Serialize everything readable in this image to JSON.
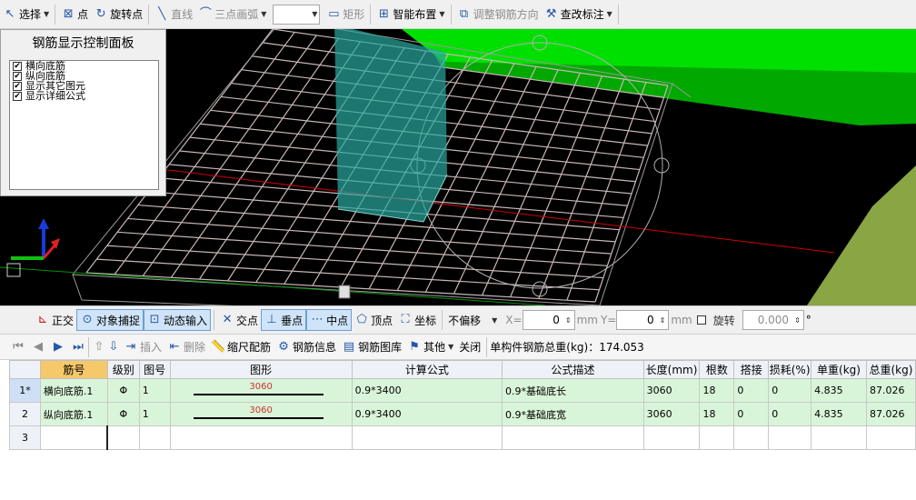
{
  "toolbar_top": {
    "select": "选择",
    "point": "点",
    "rotate_point": "旋转点",
    "line": "直线",
    "arc": "三点画弧",
    "rect": "矩形",
    "smart_layout": "智能布置",
    "adjust_dir": "调整钢筋方向",
    "check_label": "查改标注"
  },
  "panel": {
    "title": "钢筋显示控制面板",
    "items": [
      "横向底筋",
      "纵向底筋",
      "显示其它图元",
      "显示详细公式"
    ]
  },
  "toolbar_snap": {
    "ortho": "正交",
    "snap": "对象捕捉",
    "dynamic": "动态输入",
    "intersect": "交点",
    "perp": "垂点",
    "mid": "中点",
    "vertex": "顶点",
    "coord": "坐标",
    "offset": "不偏移",
    "x_label": "X=",
    "x_val": "0",
    "mm1": "mm",
    "y_label": "Y=",
    "y_val": "0",
    "mm2": "mm",
    "rotate": "旋转",
    "rotate_val": "0.000",
    "deg": "°"
  },
  "toolbar_grid": {
    "insert": "插入",
    "delete": "删除",
    "scale": "缩尺配筋",
    "info": "钢筋信息",
    "lib": "钢筋图库",
    "other": "其他",
    "close": "关闭",
    "total": "单构件钢筋总重(kg)：174.053"
  },
  "table": {
    "headers": [
      "",
      "筋号",
      "级别",
      "图号",
      "图形",
      "计算公式",
      "公式描述",
      "长度(mm)",
      "根数",
      "搭接",
      "损耗(%)",
      "单重(kg)",
      "总重(kg)"
    ],
    "rows": [
      {
        "no": "1*",
        "name": "横向底筋.1",
        "grade": "Φ",
        "fig": "1",
        "len_label": "3060",
        "formula": "0.9*3400",
        "desc": "0.9*基础底长",
        "length": "3060",
        "count": "18",
        "lap": "0",
        "loss": "0",
        "unit_w": "4.835",
        "total_w": "87.026"
      },
      {
        "no": "2",
        "name": "纵向底筋.1",
        "grade": "Φ",
        "fig": "1",
        "len_label": "3060",
        "formula": "0.9*3400",
        "desc": "0.9*基础底宽",
        "length": "3060",
        "count": "18",
        "lap": "0",
        "loss": "0",
        "unit_w": "4.835",
        "total_w": "87.026"
      }
    ],
    "empty_row_no": "3"
  }
}
